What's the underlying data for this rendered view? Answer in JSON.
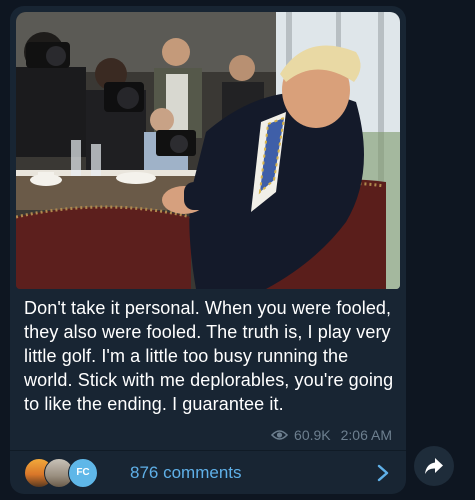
{
  "post": {
    "text": "Don't take it personal. When you were fooled, they also were fooled. The truth is, I play very little golf. I'm a little too busy running the world. Stick with me deplorables, you're going to like the ending. I guarantee it.",
    "views": "60.9K",
    "time": "2:06 AM"
  },
  "comments": {
    "label": "876 comments",
    "avatars": [
      {
        "name": "sunset-avatar"
      },
      {
        "name": "landscape-avatar"
      },
      {
        "initials": "FC"
      }
    ]
  },
  "icons": {
    "views": "eye-icon",
    "open_comments": "chevron-right-icon",
    "share": "share-arrow-icon"
  },
  "colors": {
    "background": "#0e1621",
    "bubble": "#182533",
    "link": "#5fb0e8",
    "meta": "#6d7f8f"
  }
}
